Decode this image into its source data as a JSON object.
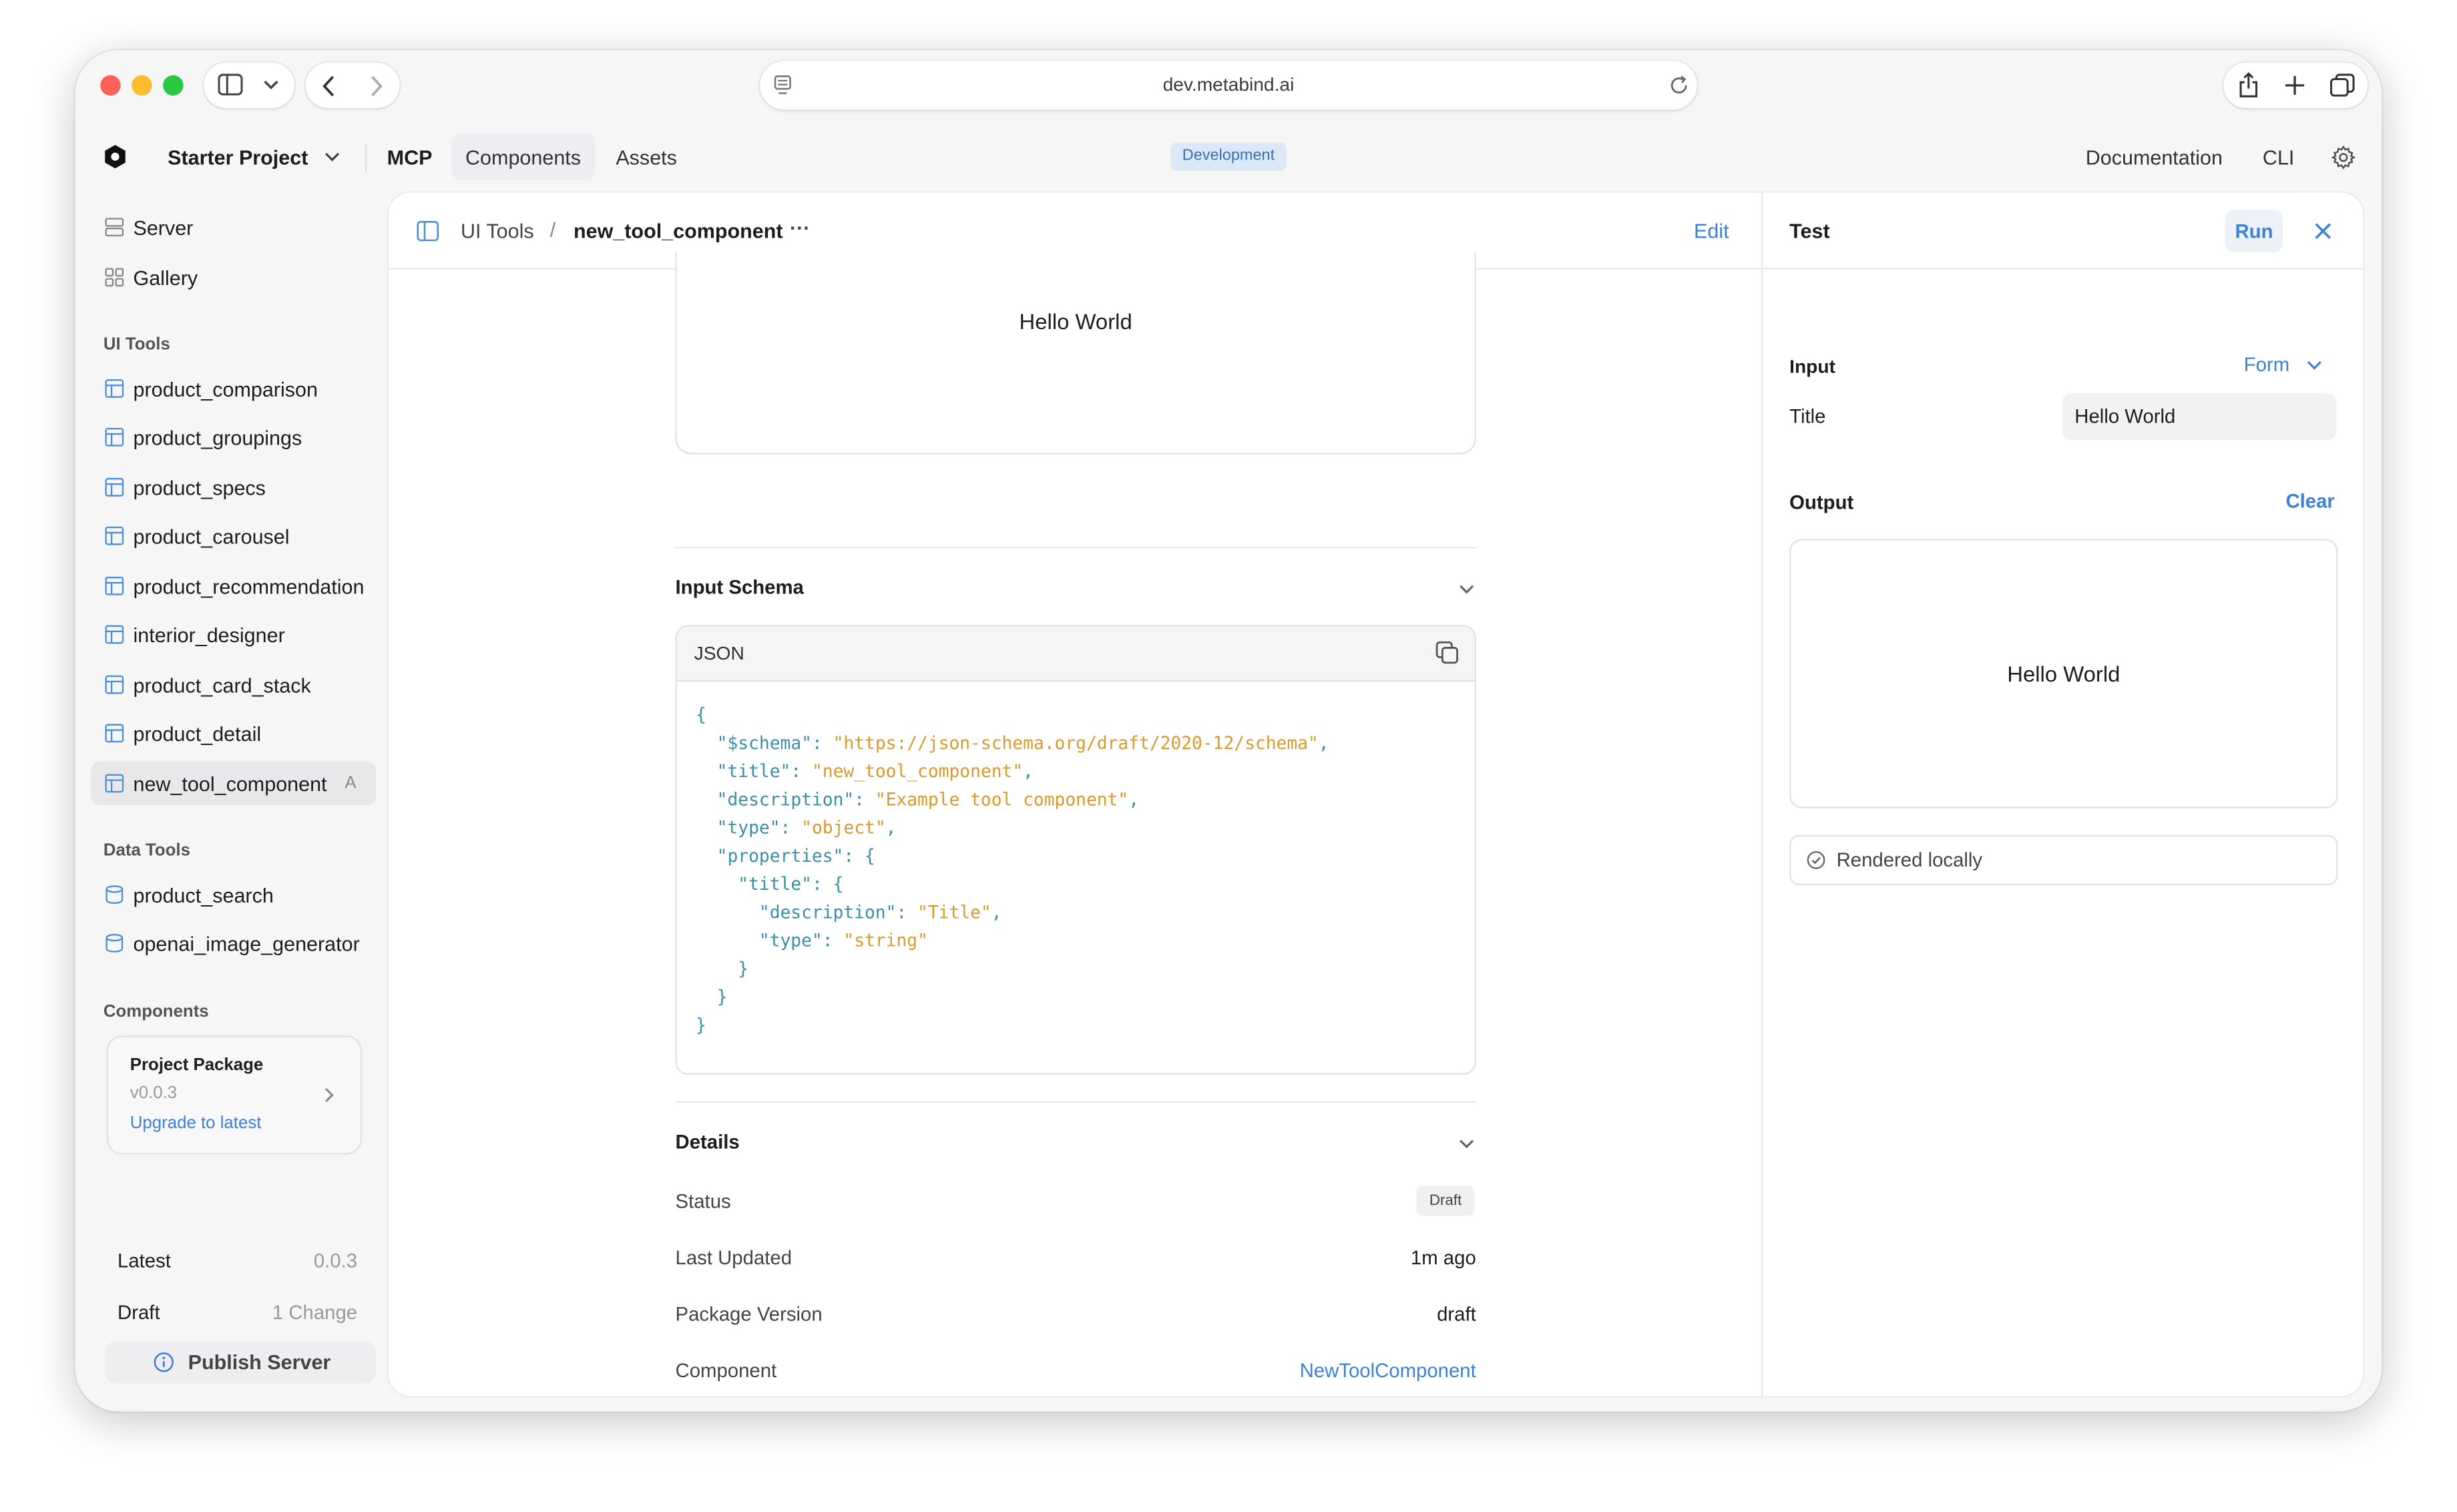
{
  "browser": {
    "url": "dev.metabind.ai"
  },
  "header": {
    "project": "Starter Project",
    "tabs": [
      "MCP",
      "Components",
      "Assets"
    ],
    "environment_badge": "Development",
    "links": [
      "Documentation",
      "CLI"
    ]
  },
  "sidebar": {
    "top_items": [
      {
        "label": "Server",
        "icon": "server-icon"
      },
      {
        "label": "Gallery",
        "icon": "grid-icon"
      }
    ],
    "ui_tools_title": "UI Tools",
    "ui_tools": [
      "product_comparison",
      "product_groupings",
      "product_specs",
      "product_carousel",
      "product_recommendation",
      "interior_designer",
      "product_card_stack",
      "product_detail",
      "new_tool_component"
    ],
    "active_badge": "A",
    "data_tools_title": "Data Tools",
    "data_tools": [
      "product_search",
      "openai_image_generator"
    ],
    "components_title": "Components",
    "package": {
      "name": "Project Package",
      "version": "v0.0.3",
      "upgrade": "Upgrade to latest"
    },
    "latest_label": "Latest",
    "latest_value": "0.0.3",
    "draft_label": "Draft",
    "draft_value": "1 Change",
    "publish_label": "Publish Server"
  },
  "editor": {
    "breadcrumb_parent": "UI Tools",
    "breadcrumb_sep": "/",
    "breadcrumb_current": "new_tool_component",
    "more": "···",
    "edit_label": "Edit",
    "preview_text": "Hello World",
    "input_schema_title": "Input Schema",
    "json_label": "JSON",
    "schema_json": {
      "schema_key": "\"$schema\"",
      "schema_value": "\"https://json-schema.org/draft/2020-12/schema\"",
      "title_key": "\"title\"",
      "title_value": "\"new_tool_component\"",
      "description_key": "\"description\"",
      "description_value": "\"Example tool component\"",
      "type_key": "\"type\"",
      "type_value": "\"object\"",
      "properties_key": "\"properties\"",
      "prop_title_key": "\"title\"",
      "prop_description_key": "\"description\"",
      "prop_description_value": "\"Title\"",
      "prop_type_key": "\"type\"",
      "prop_type_value": "\"string\""
    },
    "details_title": "Details",
    "details": {
      "status_label": "Status",
      "status_value": "Draft",
      "updated_label": "Last Updated",
      "updated_value": "1m ago",
      "package_label": "Package Version",
      "package_value": "draft",
      "component_label": "Component",
      "component_value": "NewToolComponent"
    }
  },
  "test_panel": {
    "title": "Test",
    "run_label": "Run",
    "input_label": "Input",
    "mode_label": "Form",
    "field_label": "Title",
    "field_value": "Hello World",
    "output_label": "Output",
    "clear_label": "Clear",
    "output_text": "Hello World",
    "status_text": "Rendered locally"
  },
  "colors": {
    "accent": "#3b82d6",
    "json_key": "#3a8fa8",
    "json_string": "#d99a2b",
    "badge_bg": "#dbe8f8"
  }
}
